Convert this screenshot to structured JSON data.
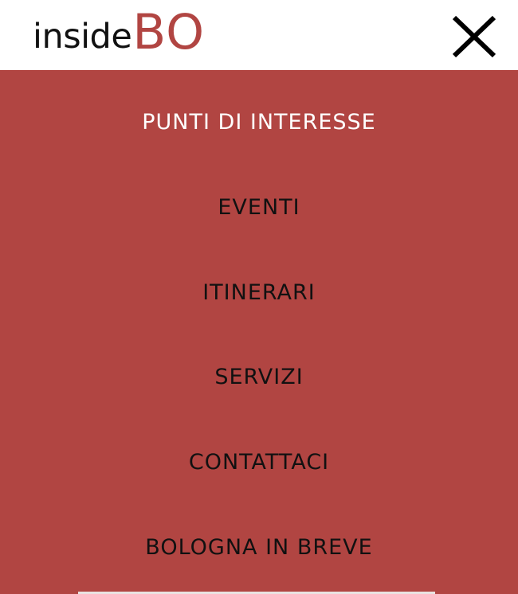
{
  "header": {
    "logo": {
      "part_inside": "inside",
      "part_bo": "BO"
    },
    "close_icon": "close-icon"
  },
  "menu": {
    "items": [
      {
        "label": "PUNTI DI INTERESSE",
        "active": true
      },
      {
        "label": "EVENTI",
        "active": false
      },
      {
        "label": "ITINERARI",
        "active": false
      },
      {
        "label": "SERVIZI",
        "active": false
      },
      {
        "label": "CONTATTACI",
        "active": false
      },
      {
        "label": "BOLOGNA IN BREVE",
        "active": false
      }
    ]
  },
  "colors": {
    "brand_red": "#b14542",
    "header_bg": "#ffffff",
    "text_dark": "#111111",
    "text_active": "#ffffff"
  }
}
